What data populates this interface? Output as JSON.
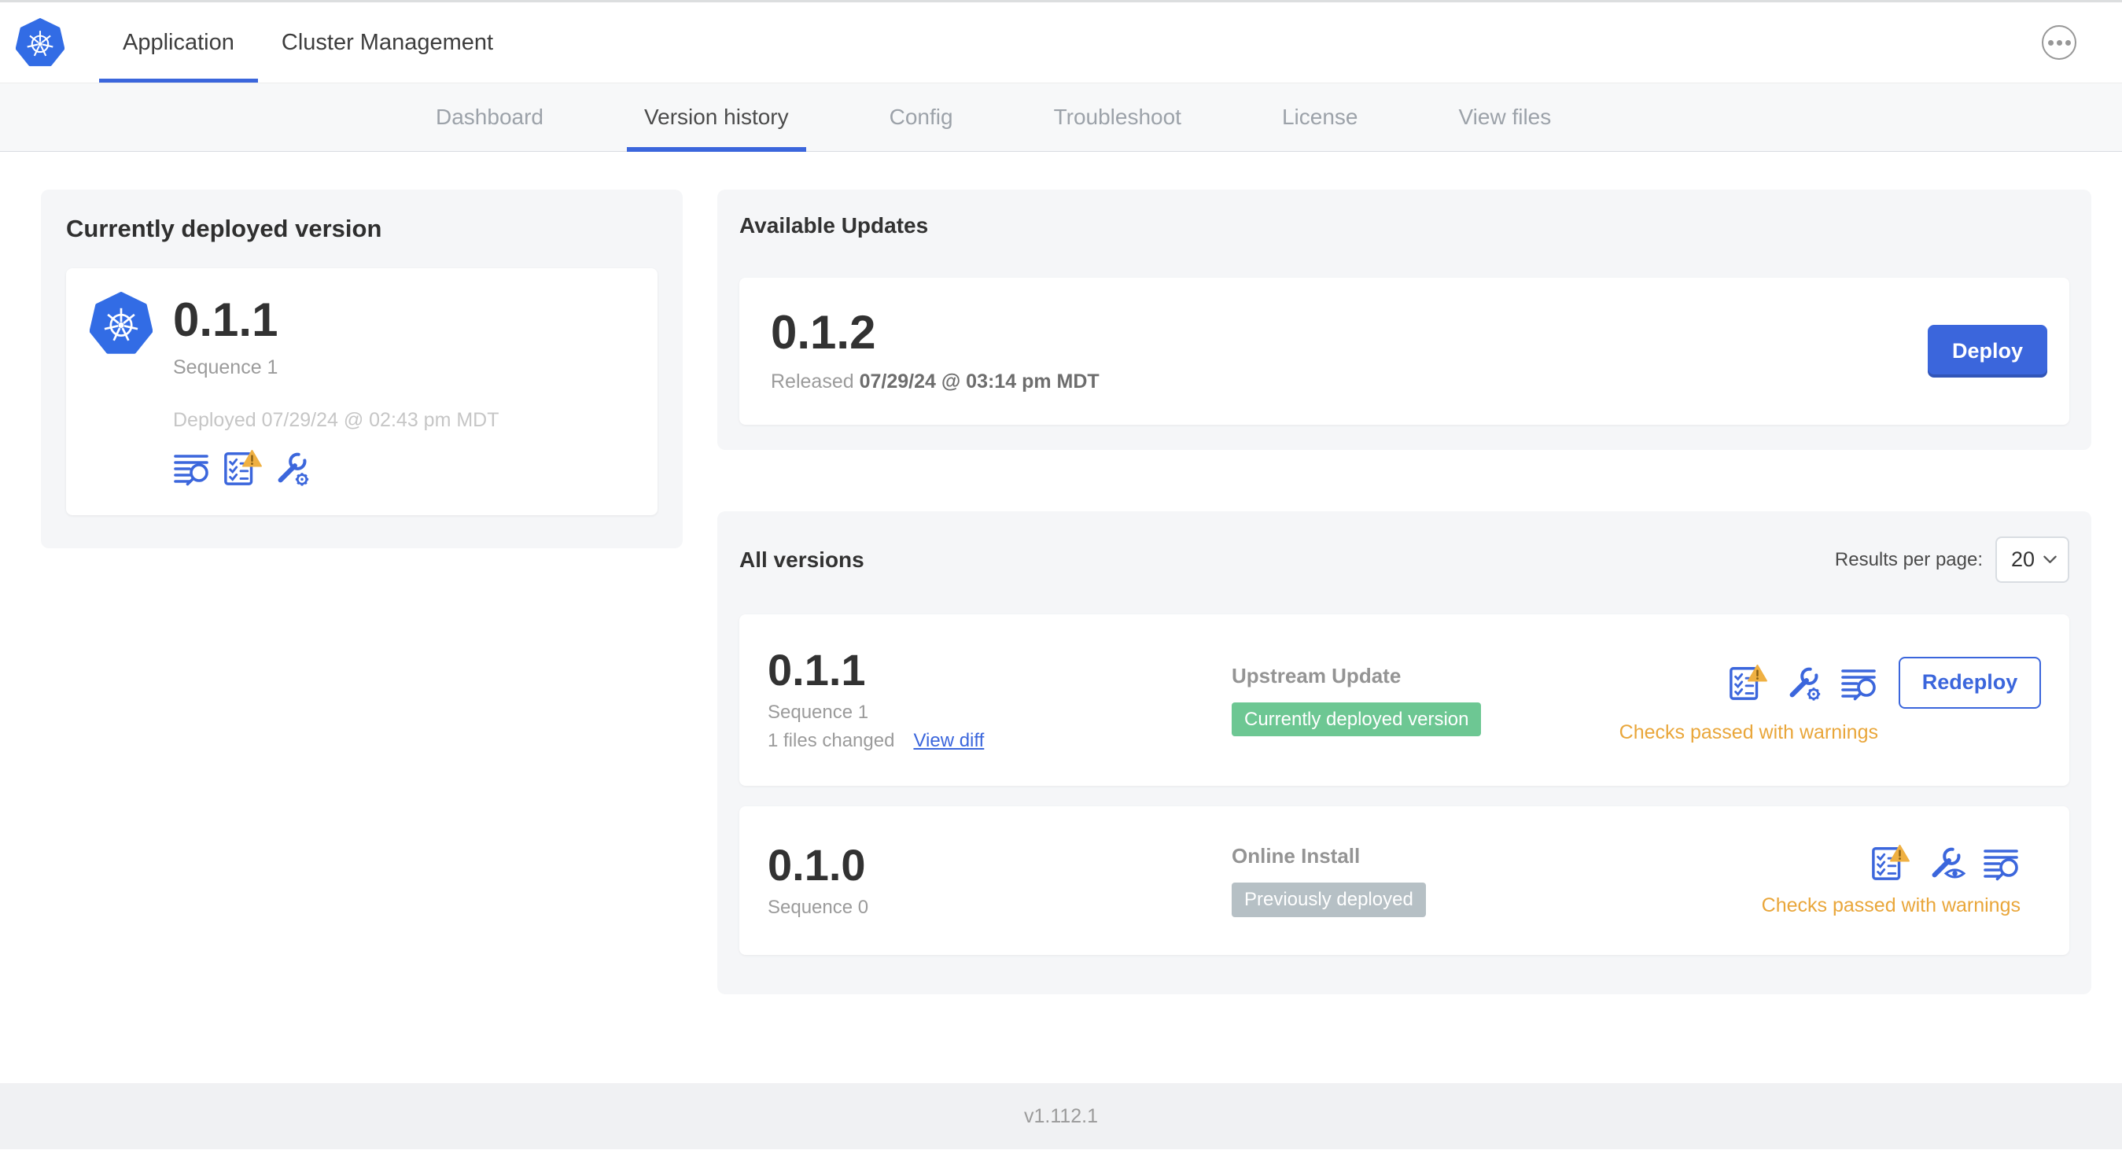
{
  "header": {
    "brand_icon": "kubernetes-logo",
    "tabs": [
      {
        "label": "Application",
        "active": true
      },
      {
        "label": "Cluster Management",
        "active": false
      }
    ],
    "more_menu_icon": "ellipsis"
  },
  "nav": {
    "tabs": [
      {
        "label": "Dashboard",
        "active": false
      },
      {
        "label": "Version history",
        "active": true
      },
      {
        "label": "Config",
        "active": false
      },
      {
        "label": "Troubleshoot",
        "active": false
      },
      {
        "label": "License",
        "active": false
      },
      {
        "label": "View files",
        "active": false
      }
    ]
  },
  "current_version": {
    "title": "Currently deployed version",
    "version": "0.1.1",
    "sequence": "Sequence 1",
    "deployed": "Deployed 07/29/24 @ 02:43 pm MDT",
    "icons": [
      "diff-icon",
      "preflight-checks-warning-icon",
      "edit-config-icon"
    ]
  },
  "available_updates": {
    "title": "Available Updates",
    "update": {
      "version": "0.1.2",
      "released_label": "Released",
      "released_date": "07/29/24 @ 03:14 pm MDT",
      "deploy_label": "Deploy"
    }
  },
  "all_versions": {
    "title": "All versions",
    "results_per_page_label": "Results per page:",
    "results_per_page_value": "20",
    "rows": [
      {
        "version": "0.1.1",
        "sequence": "Sequence 1",
        "files_changed": "1 files changed",
        "view_diff_label": "View diff",
        "source": "Upstream Update",
        "status_badge": "Currently deployed version",
        "badge_color": "green",
        "checks_text": "Checks passed with warnings",
        "action_label": "Redeploy",
        "icons": [
          "preflight-checks-warning-icon",
          "edit-config-icon",
          "diff-icon"
        ]
      },
      {
        "version": "0.1.0",
        "sequence": "Sequence 0",
        "source": "Online Install",
        "status_badge": "Previously deployed",
        "badge_color": "gray",
        "checks_text": "Checks passed with warnings",
        "icons": [
          "preflight-checks-warning-icon",
          "view-config-icon",
          "diff-icon"
        ]
      }
    ]
  },
  "footer": {
    "version": "v1.112.1"
  },
  "colors": {
    "accent_blue": "#3b66dc",
    "k8s_blue": "#326ce5",
    "warning_amber": "#e9a63a",
    "success_green": "#6dc793",
    "neutral_badge_gray": "#b6c0c5"
  }
}
